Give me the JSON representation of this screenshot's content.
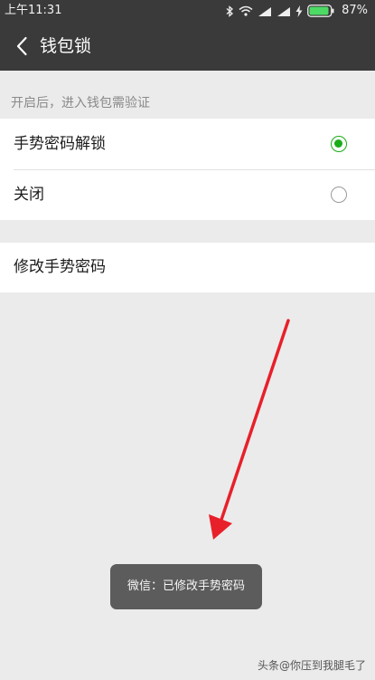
{
  "status_bar": {
    "time": "上午11:31",
    "battery_percent": "87%",
    "icons": [
      "bluetooth-icon",
      "wifi-icon",
      "signal-icon",
      "signal-icon",
      "charging-icon",
      "battery-icon"
    ]
  },
  "nav": {
    "back_icon": "chevron-left-icon",
    "title": "钱包锁"
  },
  "hint": "开启后，进入钱包需验证",
  "options": [
    {
      "label": "手势密码解锁",
      "selected": true
    },
    {
      "label": "关闭",
      "selected": false
    }
  ],
  "modify_label": "修改手势密码",
  "toast": "微信：已修改手势密码",
  "watermark": "头条@你压到我腿毛了",
  "colors": {
    "nav_bg": "#3a3a3a",
    "page_bg": "#ebebeb",
    "accent_green": "#1aad19",
    "arrow_red": "#e8202a",
    "toast_bg": "#5c5c5c"
  }
}
